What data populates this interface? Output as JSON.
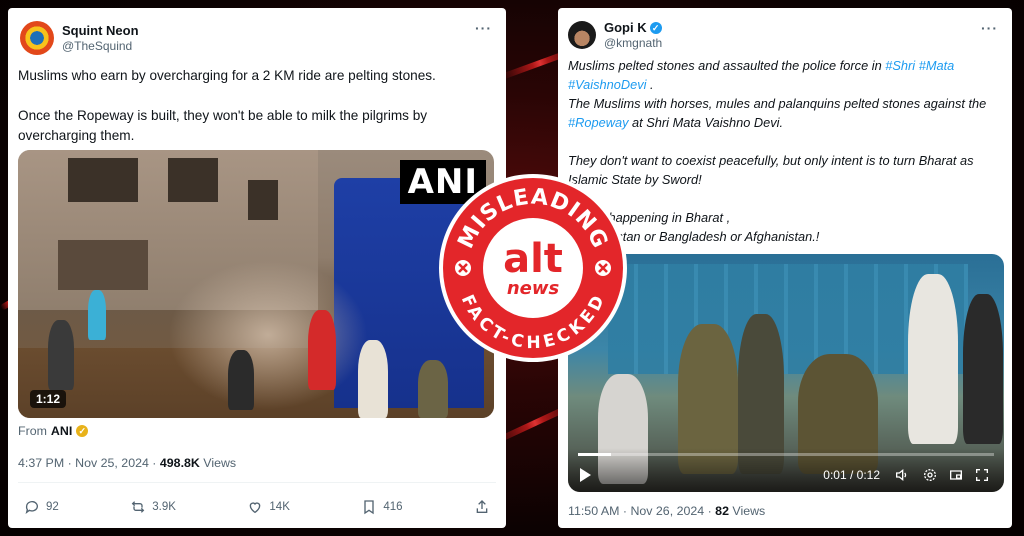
{
  "colors": {
    "link": "#1d9bf0",
    "muted": "#536471",
    "seal_red": "#e3262a"
  },
  "left_tweet": {
    "display_name": "Squint Neon",
    "handle": "@TheSquind",
    "more": "···",
    "text": [
      "Muslims who earn by overcharging for a 2 KM ride are pelting stones.",
      "Once the Ropeway is built, they won't be able to milk the pilgrims by overcharging them."
    ],
    "media": {
      "watermark": "ANI",
      "duration": "1:12"
    },
    "from_prefix": "From",
    "from_source": "ANI",
    "timestamp": "4:37 PM · Nov 25, 2024 · ",
    "views_count": "498.8K",
    "views_label": " Views",
    "actions": {
      "replies": "92",
      "reposts": "3.9K",
      "likes": "14K",
      "bookmarks": "416"
    }
  },
  "right_tweet": {
    "display_name": "Gopi K",
    "handle": "@kmgnath",
    "more": "···",
    "line1_pre": "Muslims pelted stones and assaulted the police force in ",
    "tags1": [
      "#Shri",
      "#Mata",
      "#VaishnoDevi"
    ],
    "line1_post": " .",
    "line2_pre": "The Muslims with horses, mules and palanquins pelted stones against the ",
    "tag2": "#Ropeway",
    "line2_post": " at Shri Mata Vaishno Devi.",
    "line3": "They don't want to coexist peacefully, but only intent is to turn Bharat as Islamic State by Sword!",
    "line4": "This is happening in Bharat ,",
    "line5": "Not Pakistan or Bangladesh or Afghanistan.!",
    "media": {
      "time": "0:01 / 0:12",
      "progress": 0.08
    },
    "timestamp": "11:50 AM · Nov 26, 2024 · ",
    "views_count": "82",
    "views_label": " Views"
  },
  "seal": {
    "top_text": "MISLEADING",
    "brand_alt": "alt",
    "brand_news": "news",
    "bottom_text": "FACT-CHECKED"
  }
}
